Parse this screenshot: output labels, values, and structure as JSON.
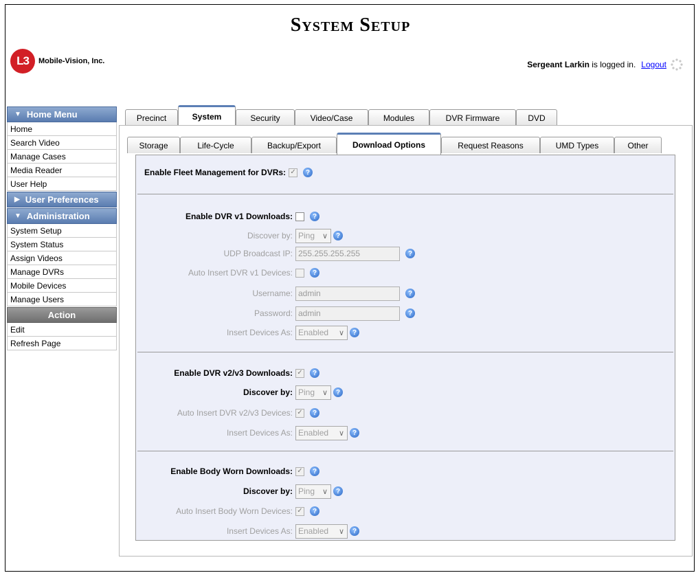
{
  "header": {
    "title": "System Setup",
    "logo_mark": "L3",
    "company": "Mobile-Vision, Inc.",
    "user_name": "Sergeant Larkin",
    "login_suffix": "is logged in.",
    "logout_label": "Logout"
  },
  "sidebar": {
    "home_menu": {
      "label": "Home Menu",
      "items": [
        "Home",
        "Search Video",
        "Manage Cases",
        "Media Reader",
        "User Help"
      ]
    },
    "user_prefs": {
      "label": "User Preferences"
    },
    "administration": {
      "label": "Administration",
      "items": [
        "System Setup",
        "System Status",
        "Assign Videos",
        "Manage DVRs",
        "Mobile Devices",
        "Manage Users"
      ]
    },
    "action": {
      "label": "Action",
      "items": [
        "Edit",
        "Refresh Page"
      ]
    }
  },
  "tabs": {
    "main": [
      "Precinct",
      "System",
      "Security",
      "Video/Case",
      "Modules",
      "DVR Firmware",
      "DVD"
    ],
    "main_active": "System",
    "sub": [
      "Storage",
      "Life-Cycle",
      "Backup/Export",
      "Download Options",
      "Request Reasons",
      "UMD Types",
      "Other"
    ],
    "sub_active": "Download Options"
  },
  "form": {
    "fleet": {
      "label": "Enable Fleet Management for DVRs:",
      "checked": true
    },
    "v1": {
      "enable_label": "Enable DVR v1 Downloads:",
      "enable_checked": false,
      "discover_label": "Discover by:",
      "discover_value": "Ping",
      "udp_label": "UDP Broadcast IP:",
      "udp_value": "255.255.255.255",
      "auto_label": "Auto Insert DVR v1 Devices:",
      "auto_checked": false,
      "username_label": "Username:",
      "username_value": "admin",
      "password_label": "Password:",
      "password_value": "admin",
      "insert_label": "Insert Devices As:",
      "insert_value": "Enabled"
    },
    "v2v3": {
      "enable_label": "Enable DVR v2/v3 Downloads:",
      "enable_checked": true,
      "discover_label": "Discover by:",
      "discover_value": "Ping",
      "auto_label": "Auto Insert DVR v2/v3 Devices:",
      "auto_checked": true,
      "insert_label": "Insert Devices As:",
      "insert_value": "Enabled"
    },
    "body": {
      "enable_label": "Enable Body Worn Downloads:",
      "enable_checked": true,
      "discover_label": "Discover by:",
      "discover_value": "Ping",
      "auto_label": "Auto Insert Body Worn Devices:",
      "auto_checked": true,
      "insert_label": "Insert Devices As:",
      "insert_value": "Enabled"
    }
  },
  "icons": {
    "help": "help-icon",
    "check": "✓",
    "chevron": "∨",
    "collapse": "▼",
    "expand": "▶"
  }
}
